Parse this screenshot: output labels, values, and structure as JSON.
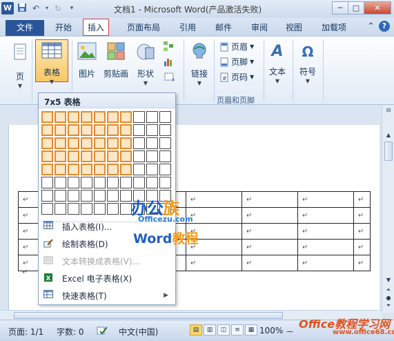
{
  "titlebar": {
    "title": "文档1 - Microsoft Word(产品激活失败)",
    "app_icon": "W",
    "minimize": "─",
    "restore": "□",
    "close": "✕"
  },
  "tabs": {
    "file": "文件",
    "items": [
      "开始",
      "插入",
      "页面布局",
      "引用",
      "邮件",
      "审阅",
      "视图",
      "加载项"
    ],
    "active": "插入"
  },
  "ribbon": {
    "page": "页",
    "table": "表格",
    "picture": "图片",
    "clipart": "剪贴画",
    "shapes": "形状",
    "link": "链接",
    "header": "页眉",
    "footer": "页脚",
    "pagenum": "页码",
    "header_footer_group": "页眉和页脚",
    "text": "文本",
    "symbol": "符号",
    "omega": "Ω",
    "text_icon": "A"
  },
  "dropdown": {
    "header": "7x5 表格",
    "grid_cols": 10,
    "grid_rows": 8,
    "selected_cols": 7,
    "selected_rows": 5,
    "items": [
      {
        "label": "插入表格(I)...",
        "icon": "table-icon",
        "disabled": false,
        "submenu": false
      },
      {
        "label": "绘制表格(D)",
        "icon": "pencil-icon",
        "disabled": false,
        "submenu": false
      },
      {
        "label": "文本转换成表格(V)...",
        "icon": "convert-icon",
        "disabled": true,
        "submenu": false
      },
      {
        "label": "Excel 电子表格(X)",
        "icon": "excel-icon",
        "disabled": false,
        "submenu": false
      },
      {
        "label": "快速表格(T)",
        "icon": "quick-table-icon",
        "disabled": false,
        "submenu": true
      }
    ]
  },
  "document": {
    "paragraph_mark": "↵"
  },
  "watermark": {
    "line1_a": "办公",
    "line1_b": "族",
    "line2": "Officezu.com",
    "line3_a": "Word",
    "line3_b": "教程",
    "site": "Office教程学习网",
    "site_url": "www.office68.com"
  },
  "statusbar": {
    "page": "页面: 1/1",
    "words": "字数: 0",
    "language": "中文(中国)",
    "zoom": "100%",
    "minus": "－"
  }
}
